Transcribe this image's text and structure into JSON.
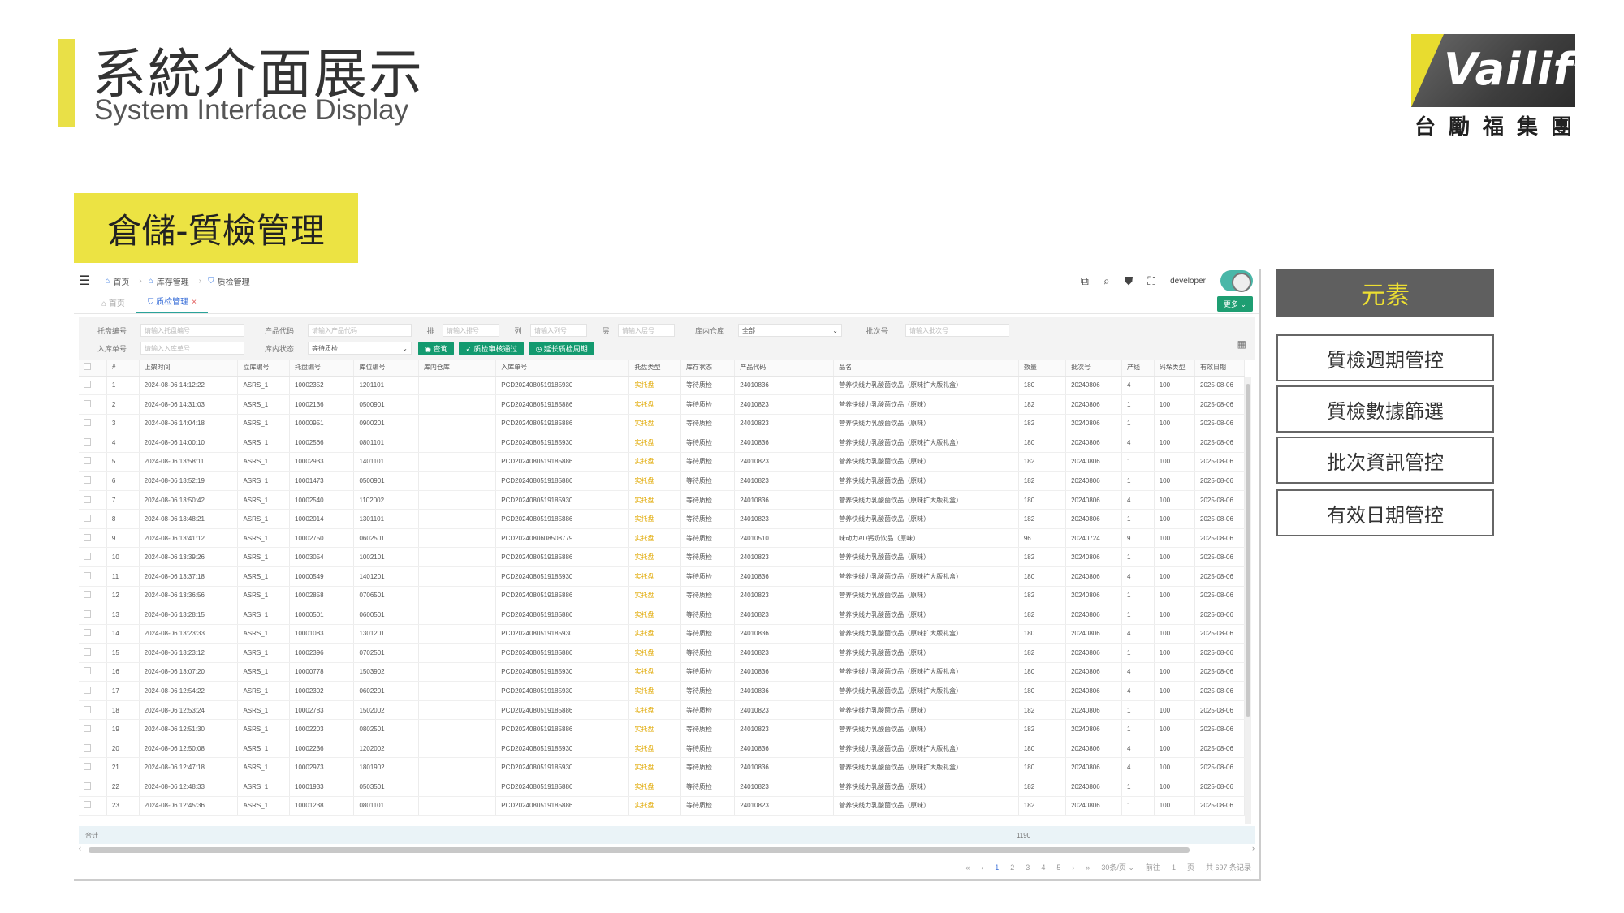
{
  "slide": {
    "title": "系統介面展示",
    "subtitle": "System Interface Display",
    "section_tag": "倉儲-質檢管理",
    "accent_color": "#e9e047"
  },
  "logo": {
    "text": "Vailift",
    "cn": [
      "台",
      "勵",
      "福",
      "集",
      "團"
    ]
  },
  "app": {
    "breadcrumb": [
      "首页",
      "库存管理",
      "质检管理"
    ],
    "user": "developer",
    "tabs": [
      {
        "label": "首页",
        "active": false
      },
      {
        "label": "质检管理",
        "active": true
      }
    ],
    "more_label": "更多",
    "filters": {
      "row1": [
        {
          "label": "托盘编号",
          "placeholder": "请输入托盘编号"
        },
        {
          "label": "产品代码",
          "placeholder": "请输入产品代码"
        },
        {
          "label": "排",
          "placeholder": "请输入排号"
        },
        {
          "label": "列",
          "placeholder": "请输入列号"
        },
        {
          "label": "层",
          "placeholder": "请输入层号"
        },
        {
          "label": "库内仓库",
          "value": "全部"
        },
        {
          "label": "批次号",
          "placeholder": "请输入批次号"
        }
      ],
      "row2": [
        {
          "label": "入库单号",
          "placeholder": "请输入入库单号"
        },
        {
          "label": "库内状态",
          "value": "等待质检"
        }
      ],
      "buttons": [
        "查询",
        "质检审核通过",
        "延长质检周期"
      ]
    },
    "columns": [
      "#",
      "上架时间",
      "立库编号",
      "托盘编号",
      "库位编号",
      "库内仓库",
      "入库单号",
      "托盘类型",
      "库存状态",
      "产品代码",
      "品名",
      "数量",
      "批次号",
      "产线",
      "码垛类型",
      "有效日期"
    ],
    "rows": [
      [
        "1",
        "2024-08-06 14:12:22",
        "ASRS_1",
        "10002352",
        "1201101",
        "",
        "PCD2024080519185930",
        "实托盘",
        "等待质检",
        "24010836",
        "营养快线力乳酸菌饮品（原味扩大版礼盒）",
        "180",
        "20240806",
        "4",
        "100",
        "2025-08-06"
      ],
      [
        "2",
        "2024-08-06 14:31:03",
        "ASRS_1",
        "10002136",
        "0500901",
        "",
        "PCD2024080519185886",
        "实托盘",
        "等待质检",
        "24010823",
        "营养快线力乳酸菌饮品（原味）",
        "182",
        "20240806",
        "1",
        "100",
        "2025-08-06"
      ],
      [
        "3",
        "2024-08-06 14:04:18",
        "ASRS_1",
        "10000951",
        "0900201",
        "",
        "PCD2024080519185886",
        "实托盘",
        "等待质检",
        "24010823",
        "营养快线力乳酸菌饮品（原味）",
        "182",
        "20240806",
        "1",
        "100",
        "2025-08-06"
      ],
      [
        "4",
        "2024-08-06 14:00:10",
        "ASRS_1",
        "10002566",
        "0801101",
        "",
        "PCD2024080519185930",
        "实托盘",
        "等待质检",
        "24010836",
        "营养快线力乳酸菌饮品（原味扩大版礼盒）",
        "180",
        "20240806",
        "4",
        "100",
        "2025-08-06"
      ],
      [
        "5",
        "2024-08-06 13:58:11",
        "ASRS_1",
        "10002933",
        "1401101",
        "",
        "PCD2024080519185886",
        "实托盘",
        "等待质检",
        "24010823",
        "营养快线力乳酸菌饮品（原味）",
        "182",
        "20240806",
        "1",
        "100",
        "2025-08-06"
      ],
      [
        "6",
        "2024-08-06 13:52:19",
        "ASRS_1",
        "10001473",
        "0500901",
        "",
        "PCD2024080519185886",
        "实托盘",
        "等待质检",
        "24010823",
        "营养快线力乳酸菌饮品（原味）",
        "182",
        "20240806",
        "1",
        "100",
        "2025-08-06"
      ],
      [
        "7",
        "2024-08-06 13:50:42",
        "ASRS_1",
        "10002540",
        "1102002",
        "",
        "PCD2024080519185930",
        "实托盘",
        "等待质检",
        "24010836",
        "营养快线力乳酸菌饮品（原味扩大版礼盒）",
        "180",
        "20240806",
        "4",
        "100",
        "2025-08-06"
      ],
      [
        "8",
        "2024-08-06 13:48:21",
        "ASRS_1",
        "10002014",
        "1301101",
        "",
        "PCD2024080519185886",
        "实托盘",
        "等待质检",
        "24010823",
        "营养快线力乳酸菌饮品（原味）",
        "182",
        "20240806",
        "1",
        "100",
        "2025-08-06"
      ],
      [
        "9",
        "2024-08-06 13:41:12",
        "ASRS_1",
        "10002750",
        "0602501",
        "",
        "PCD2024080608508779",
        "实托盘",
        "等待质检",
        "24010510",
        "味动力AD钙奶饮品（原味）",
        "96",
        "20240724",
        "9",
        "100",
        "2025-08-06"
      ],
      [
        "10",
        "2024-08-06 13:39:26",
        "ASRS_1",
        "10003054",
        "1002101",
        "",
        "PCD2024080519185886",
        "实托盘",
        "等待质检",
        "24010823",
        "营养快线力乳酸菌饮品（原味）",
        "182",
        "20240806",
        "1",
        "100",
        "2025-08-06"
      ],
      [
        "11",
        "2024-08-06 13:37:18",
        "ASRS_1",
        "10000549",
        "1401201",
        "",
        "PCD2024080519185930",
        "实托盘",
        "等待质检",
        "24010836",
        "营养快线力乳酸菌饮品（原味扩大版礼盒）",
        "180",
        "20240806",
        "4",
        "100",
        "2025-08-06"
      ],
      [
        "12",
        "2024-08-06 13:36:56",
        "ASRS_1",
        "10002858",
        "0706501",
        "",
        "PCD2024080519185886",
        "实托盘",
        "等待质检",
        "24010823",
        "营养快线力乳酸菌饮品（原味）",
        "182",
        "20240806",
        "1",
        "100",
        "2025-08-06"
      ],
      [
        "13",
        "2024-08-06 13:28:15",
        "ASRS_1",
        "10000501",
        "0600501",
        "",
        "PCD2024080519185886",
        "实托盘",
        "等待质检",
        "24010823",
        "营养快线力乳酸菌饮品（原味）",
        "182",
        "20240806",
        "1",
        "100",
        "2025-08-06"
      ],
      [
        "14",
        "2024-08-06 13:23:33",
        "ASRS_1",
        "10001083",
        "1301201",
        "",
        "PCD2024080519185930",
        "实托盘",
        "等待质检",
        "24010836",
        "营养快线力乳酸菌饮品（原味扩大版礼盒）",
        "180",
        "20240806",
        "4",
        "100",
        "2025-08-06"
      ],
      [
        "15",
        "2024-08-06 13:23:12",
        "ASRS_1",
        "10002396",
        "0702501",
        "",
        "PCD2024080519185886",
        "实托盘",
        "等待质检",
        "24010823",
        "营养快线力乳酸菌饮品（原味）",
        "182",
        "20240806",
        "1",
        "100",
        "2025-08-06"
      ],
      [
        "16",
        "2024-08-06 13:07:20",
        "ASRS_1",
        "10000778",
        "1503902",
        "",
        "PCD2024080519185930",
        "实托盘",
        "等待质检",
        "24010836",
        "营养快线力乳酸菌饮品（原味扩大版礼盒）",
        "180",
        "20240806",
        "4",
        "100",
        "2025-08-06"
      ],
      [
        "17",
        "2024-08-06 12:54:22",
        "ASRS_1",
        "10002302",
        "0602201",
        "",
        "PCD2024080519185930",
        "实托盘",
        "等待质检",
        "24010836",
        "营养快线力乳酸菌饮品（原味扩大版礼盒）",
        "180",
        "20240806",
        "4",
        "100",
        "2025-08-06"
      ],
      [
        "18",
        "2024-08-06 12:53:24",
        "ASRS_1",
        "10002783",
        "1502002",
        "",
        "PCD2024080519185886",
        "实托盘",
        "等待质检",
        "24010823",
        "营养快线力乳酸菌饮品（原味）",
        "182",
        "20240806",
        "1",
        "100",
        "2025-08-06"
      ],
      [
        "19",
        "2024-08-06 12:51:30",
        "ASRS_1",
        "10002203",
        "0802501",
        "",
        "PCD2024080519185886",
        "实托盘",
        "等待质检",
        "24010823",
        "营养快线力乳酸菌饮品（原味）",
        "182",
        "20240806",
        "1",
        "100",
        "2025-08-06"
      ],
      [
        "20",
        "2024-08-06 12:50:08",
        "ASRS_1",
        "10002236",
        "1202002",
        "",
        "PCD2024080519185930",
        "实托盘",
        "等待质检",
        "24010836",
        "营养快线力乳酸菌饮品（原味扩大版礼盒）",
        "180",
        "20240806",
        "4",
        "100",
        "2025-08-06"
      ],
      [
        "21",
        "2024-08-06 12:47:18",
        "ASRS_1",
        "10002973",
        "1801902",
        "",
        "PCD2024080519185930",
        "实托盘",
        "等待质检",
        "24010836",
        "营养快线力乳酸菌饮品（原味扩大版礼盒）",
        "180",
        "20240806",
        "4",
        "100",
        "2025-08-06"
      ],
      [
        "22",
        "2024-08-06 12:48:33",
        "ASRS_1",
        "10001933",
        "0503501",
        "",
        "PCD2024080519185886",
        "实托盘",
        "等待质检",
        "24010823",
        "营养快线力乳酸菌饮品（原味）",
        "182",
        "20240806",
        "1",
        "100",
        "2025-08-06"
      ],
      [
        "23",
        "2024-08-06 12:45:36",
        "ASRS_1",
        "10001238",
        "0801101",
        "",
        "PCD2024080519185886",
        "实托盘",
        "等待质检",
        "24010823",
        "营养快线力乳酸菌饮品（原味）",
        "182",
        "20240806",
        "1",
        "100",
        "2025-08-06"
      ]
    ],
    "summary": {
      "label": "合计",
      "quantity": "1190"
    },
    "pager": {
      "pages": [
        "1",
        "2",
        "3",
        "4",
        "5"
      ],
      "current": "1",
      "page_size": "30条/页",
      "goto_label": "前往",
      "goto_value": "1",
      "page_unit": "页",
      "total": "共 697 条记录"
    }
  },
  "side": {
    "header": "元素",
    "items": [
      "質檢週期管控",
      "質檢數據篩選",
      "批次資訊管控",
      "有效日期管控"
    ]
  }
}
